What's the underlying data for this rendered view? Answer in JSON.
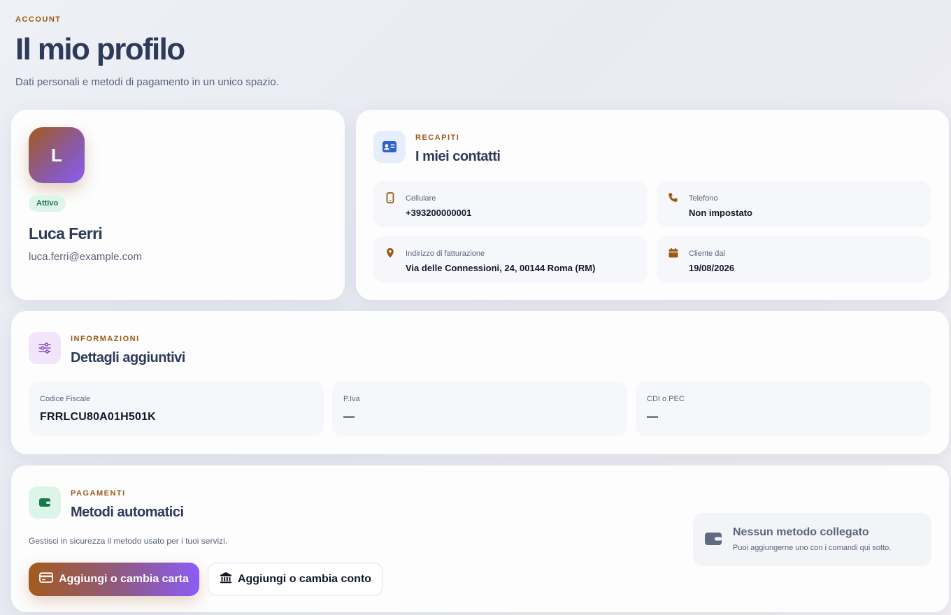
{
  "header": {
    "eyebrow": "ACCOUNT",
    "title": "Il mio profilo",
    "subtitle": "Dati personali e metodi di pagamento in un unico spazio."
  },
  "profile": {
    "initial": "L",
    "status": "Attivo",
    "name": "Luca Ferri",
    "email": "luca.ferri@example.com"
  },
  "contacts": {
    "eyebrow": "RECAPITI",
    "title": "I miei contatti",
    "icon": "contact-card-icon",
    "fields": [
      {
        "icon": "mobile-phone-icon",
        "label": "Cellulare",
        "value": "+393200000001"
      },
      {
        "icon": "phone-icon",
        "label": "Telefono",
        "value": "Non impostato"
      },
      {
        "icon": "location-pin-icon",
        "label": "Indirizzo di fatturazione",
        "value": "Via delle Connessioni, 24, 00144 Roma (RM)"
      },
      {
        "icon": "calendar-icon",
        "label": "Cliente dal",
        "value": "19/08/2026"
      }
    ]
  },
  "info": {
    "eyebrow": "INFORMAZIONI",
    "title": "Dettagli aggiuntivi",
    "icon": "sliders-icon",
    "fields": [
      {
        "label": "Codice Fiscale",
        "value": "FRRLCU80A01H501K"
      },
      {
        "label": "P.Iva",
        "value": "—"
      },
      {
        "label": "CDI o PEC",
        "value": "—"
      }
    ]
  },
  "payments": {
    "eyebrow": "PAGAMENTI",
    "title": "Metodi automatici",
    "icon": "wallet-icon",
    "description": "Gestisci in sicurezza il metodo usato per i tuoi servizi.",
    "card_button": "Aggiungi o cambia carta",
    "account_button": "Aggiungi o cambia conto",
    "empty_title": "Nessun metodo collegato",
    "empty_subtitle": "Puoi aggiungerne uno con i comandi qui sotto."
  },
  "colors": {
    "accent": "#9a5a14",
    "brand_gradient_start": "#a35a1e",
    "brand_gradient_end": "#8b5cf6",
    "text": "#2e3a59",
    "success_bg": "#dff5e8",
    "success_text": "#147a3d"
  }
}
